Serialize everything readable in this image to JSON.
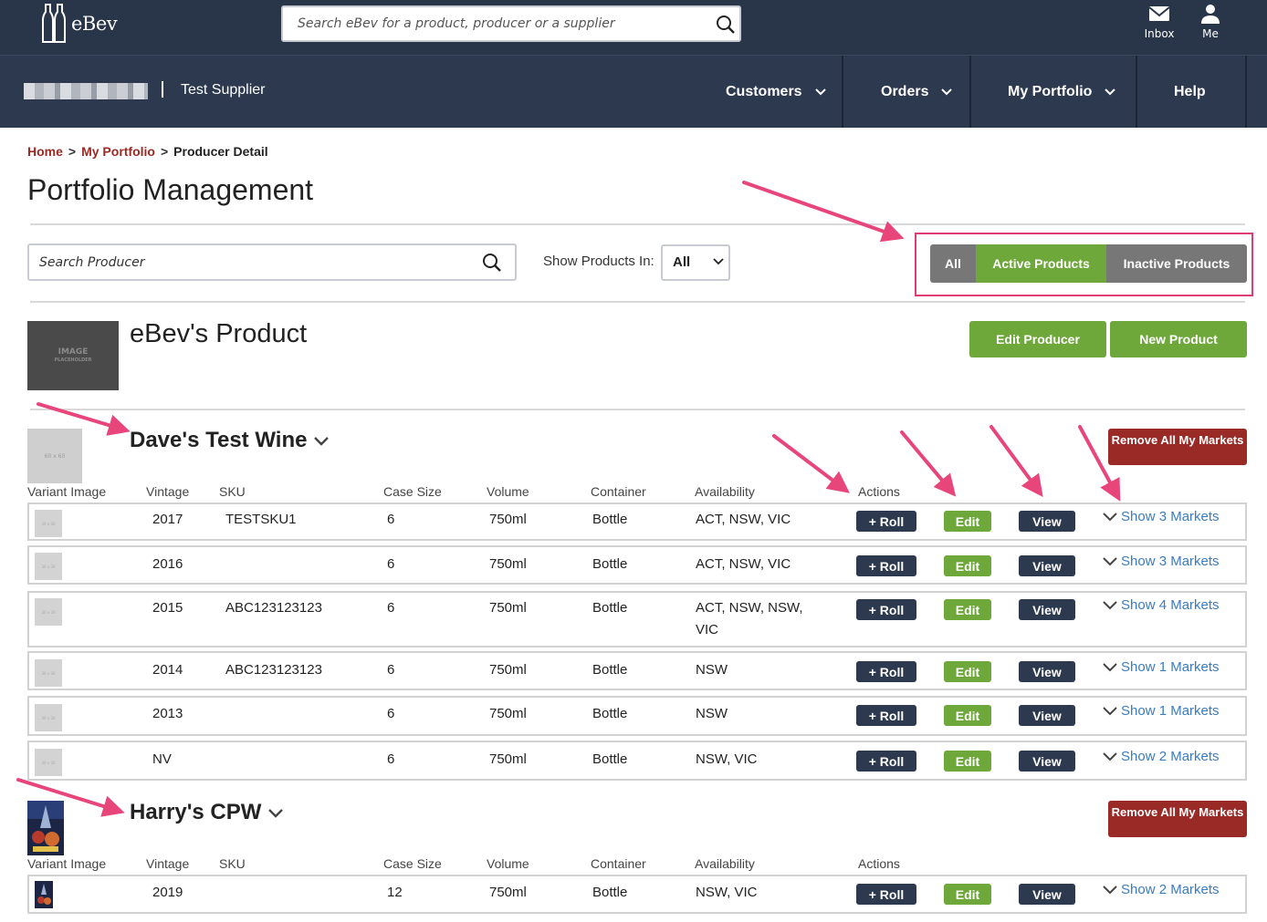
{
  "header": {
    "logo_text": "eBev",
    "search_placeholder": "Search eBev for a product, producer or a supplier",
    "inbox_label": "Inbox",
    "me_label": "Me"
  },
  "nav": {
    "supplier": "Test Supplier",
    "items": [
      {
        "label": "Customers"
      },
      {
        "label": "Orders"
      },
      {
        "label": "My Portfolio"
      },
      {
        "label": "Help"
      }
    ]
  },
  "breadcrumb": {
    "home": "Home",
    "portfolio": "My Portfolio",
    "current": "Producer Detail",
    "separator": ">"
  },
  "page_title": "Portfolio Management",
  "filters": {
    "search_placeholder": "Search Producer",
    "show_label": "Show Products In:",
    "show_value": "All",
    "buttons": {
      "all": "All",
      "active": "Active Products",
      "inactive": "Inactive Products"
    }
  },
  "producer": {
    "image_text": "IMAGE",
    "image_subtext": "PLACEHOLDER",
    "name": "eBev's Product",
    "edit_button": "Edit Producer",
    "new_button": "New Product"
  },
  "columns": {
    "variant_image": "Variant Image",
    "vintage": "Vintage",
    "sku": "SKU",
    "case_size": "Case Size",
    "volume": "Volume",
    "container": "Container",
    "availability": "Availability",
    "actions": "Actions"
  },
  "actions": {
    "roll": "+ Roll",
    "edit": "Edit",
    "view": "View",
    "remove_all": "Remove All My Markets"
  },
  "thumb_placeholder": "60 x 60",
  "row_thumb_placeholder": "30 x 30",
  "products": [
    {
      "name": "Dave's Test Wine",
      "variants": [
        {
          "vintage": "2017",
          "sku": "TESTSKU1",
          "case_size": "6",
          "volume": "750ml",
          "container": "Bottle",
          "availability": "ACT, NSW, VIC",
          "markets": "Show 3 Markets"
        },
        {
          "vintage": "2016",
          "sku": "",
          "case_size": "6",
          "volume": "750ml",
          "container": "Bottle",
          "availability": "ACT, NSW, VIC",
          "markets": "Show 3 Markets"
        },
        {
          "vintage": "2015",
          "sku": "ABC123123123",
          "case_size": "6",
          "volume": "750ml",
          "container": "Bottle",
          "availability": "ACT, NSW, NSW, VIC",
          "markets": "Show 4 Markets"
        },
        {
          "vintage": "2014",
          "sku": "ABC123123123",
          "case_size": "6",
          "volume": "750ml",
          "container": "Bottle",
          "availability": "NSW",
          "markets": "Show 1 Markets"
        },
        {
          "vintage": "2013",
          "sku": "",
          "case_size": "6",
          "volume": "750ml",
          "container": "Bottle",
          "availability": "NSW",
          "markets": "Show 1 Markets"
        },
        {
          "vintage": "NV",
          "sku": "",
          "case_size": "6",
          "volume": "750ml",
          "container": "Bottle",
          "availability": "NSW, VIC",
          "markets": "Show 2 Markets"
        }
      ]
    },
    {
      "name": "Harry's CPW",
      "variants": [
        {
          "vintage": "2019",
          "sku": "",
          "case_size": "12",
          "volume": "750ml",
          "container": "Bottle",
          "availability": "NSW, VIC",
          "markets": "Show 2 Markets"
        }
      ]
    }
  ],
  "colors": {
    "header_bg": "#293548",
    "nav_bg": "#2c394f",
    "green": "#6ea83b",
    "dark_btn": "#2c394f",
    "red_btn": "#992a26",
    "link_blue": "#3a7cc0",
    "annotation_pink": "#e03c74",
    "gray_btn": "#777777"
  }
}
